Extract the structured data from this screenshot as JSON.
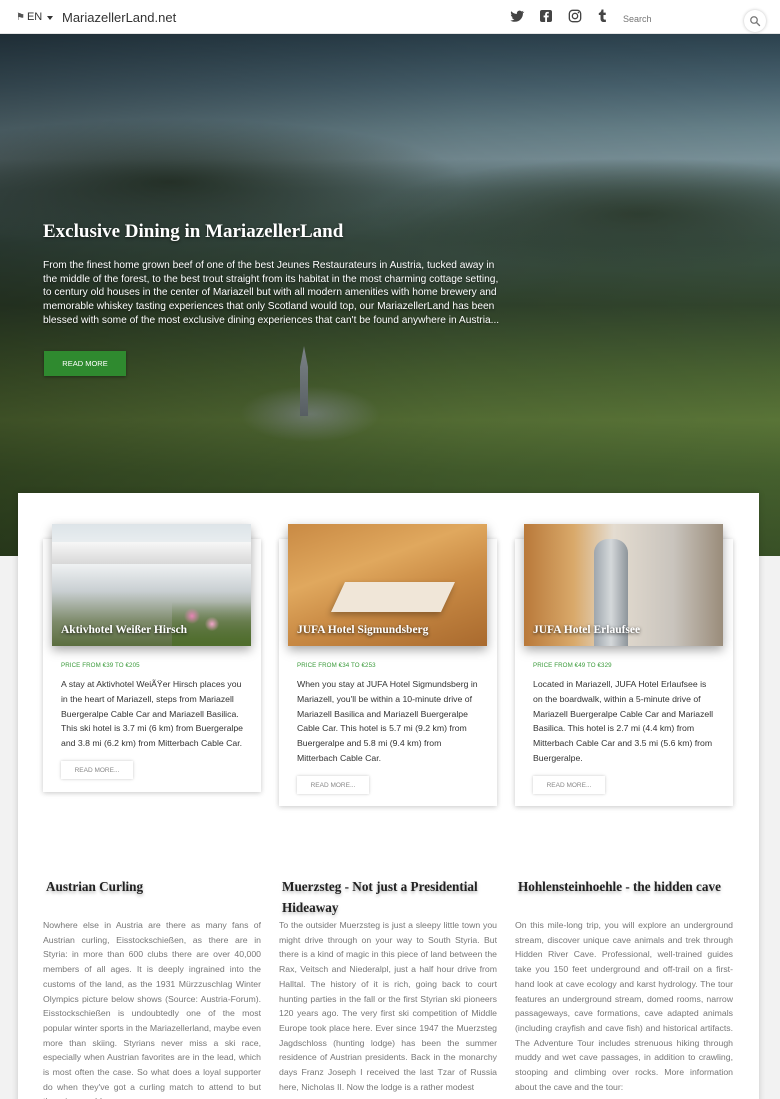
{
  "navbar": {
    "language": "EN",
    "brand": "MariazellerLand.net",
    "social_icons": [
      "twitter-icon",
      "facebook-icon",
      "instagram-icon",
      "tumblr-icon"
    ],
    "search_placeholder": "Search"
  },
  "hero": {
    "title": "Exclusive Dining in MariazellerLand",
    "text": "From the finest home grown beef of one of the best Jeunes Restaurateurs in Austria, tucked away in the middle of the forest, to the best trout straight from its habitat in the most charming cottage setting, to century old houses in the center of Mariazell but with all modern amenities with home brewery and memorable whiskey tasting experiences that only Scotland would top, our MariazellerLand has been blessed with some of the most exclusive dining experiences that can't be found anywhere in Austria...",
    "button": "READ MORE"
  },
  "hotels": [
    {
      "name": "Aktivhotel Weißer Hirsch",
      "price": "PRICE FROM €39 TO €205",
      "description": "A stay at Aktivhotel WeiÃŸer Hirsch places you in the heart of Mariazell, steps from Mariazell Buergeralpe Cable Car and Mariazell Basilica. This ski hotel is 3.7 mi (6 km) from Buergeralpe and 3.8 mi (6.2 km) from Mitterbach Cable Car.",
      "button": "READ MORE..."
    },
    {
      "name": "JUFA Hotel Sigmundsberg",
      "price": "PRICE FROM €34 TO €253",
      "description": "When you stay at JUFA Hotel Sigmundsberg in Mariazell, you'll be within a 10-minute drive of Mariazell Basilica and Mariazell Buergeralpe Cable Car. This hotel is 5.7 mi (9.2 km) from Buergeralpe and 5.8 mi (9.4 km) from Mitterbach Cable Car.",
      "button": "READ MORE..."
    },
    {
      "name": "JUFA Hotel Erlaufsee",
      "price": "PRICE FROM €49 TO €329",
      "description": "Located in Mariazell, JUFA Hotel Erlaufsee is on the boardwalk, within a 5-minute drive of Mariazell Buergeralpe Cable Car and Mariazell Basilica. This hotel is 2.7 mi (4.4 km) from Mitterbach Cable Car and 3.5 mi (5.6 km) from Buergeralpe.",
      "button": "READ MORE..."
    }
  ],
  "articles": [
    {
      "title": "Austrian Curling",
      "text": "Nowhere else in Austria are there as many fans of Austrian curling, Eisstockschießen, as there are in Styria: in more than 600 clubs there are over 40,000 members of all ages. It is deeply ingrained into the customs of the land, as the 1931 Mürzzuschlag Winter Olympics picture below shows (Source: Austria-Forum). Eisstockschießen is undoubtedly one of the most popular winter sports in the Mariazellerland, maybe even more than skiing. Styrians never miss a ski race, especially when Austrian favorites are in the lead, which is most often the case. So what does a loyal supporter do when they've got a curling match to attend to but there is a world cup race"
    },
    {
      "title": "Muerzsteg - Not just a Presidential Hideaway",
      "text": "To the outsider Muerzsteg is just a sleepy little town you might drive through on your way to South Styria. But there is a kind of magic in this piece of land between the Rax, Veitsch and Niederalpl, just a half hour drive from Halltal. The history of it is rich, going back to court hunting parties in the fall or the first Styrian ski pioneers 120 years ago. The very first ski competition of Middle Europe took place here. Ever since 1947 the Muerzsteg Jagdschloss (hunting lodge) has been the summer residence of Austrian presidents. Back in the monarchy days Franz Joseph I received the last Tzar of Russia here, Nicholas II. Now the lodge is a rather modest"
    },
    {
      "title": "Hohlensteinhoehle - the hidden cave",
      "text": "On this mile-long trip, you will explore an underground stream, discover unique cave animals and trek through Hidden River Cave. Professional, well-trained guides take you 150 feet underground and off-trail on a first-hand look at cave ecology and karst hydrology. The tour features an underground stream, domed rooms, narrow passageways, cave formations, cave adapted animals (including crayfish and cave fish) and historical artifacts. The Adventure Tour includes strenuous hiking through muddy and wet cave passages, in addition to crawling, stooping and climbing over rocks. More information about the cave and the tour:"
    }
  ],
  "colors": {
    "accent_green": "#2f8a2f",
    "price_green": "#3a9a3a"
  }
}
